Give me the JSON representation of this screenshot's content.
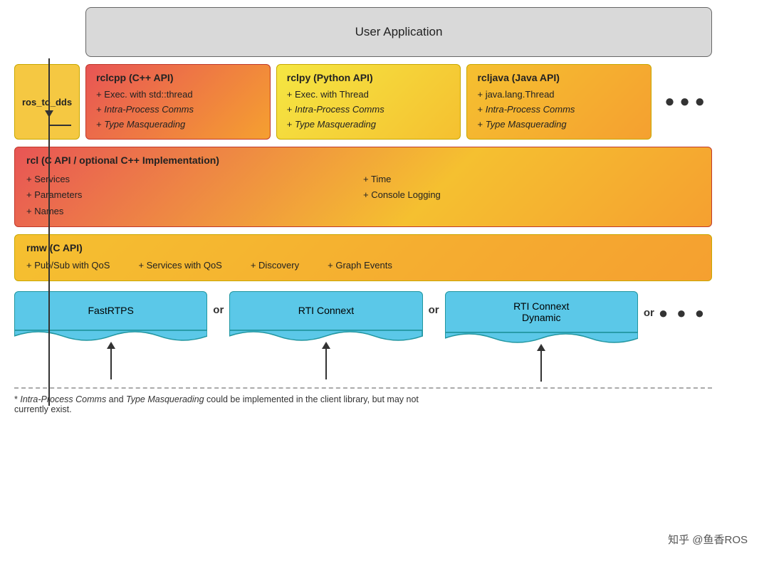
{
  "diagram": {
    "user_app": {
      "label": "User Application"
    },
    "ros_to_dds": {
      "label": "ros_to_dds"
    },
    "rclcpp": {
      "title": "rclcpp (C++ API)",
      "items": [
        "+ Exec. with std::thread",
        "+ Intra-Process Comms",
        "+ Type Masquerading"
      ]
    },
    "rclpy": {
      "title": "rclpy (Python API)",
      "items": [
        "+ Exec. with Thread",
        "+ Intra-Process Comms",
        "+ Type Masquerading"
      ]
    },
    "rcljava": {
      "title": "rcljava (Java API)",
      "items": [
        "+ java.lang.Thread",
        "+ Intra-Process Comms",
        "+ Type Masquerading"
      ]
    },
    "dots": "● ● ●",
    "rcl": {
      "title": "rcl (C API / optional C++ Implementation)",
      "col1": [
        "+ Services",
        "+ Parameters",
        "+ Names"
      ],
      "col2": [
        "+ Time",
        "+ Console Logging"
      ]
    },
    "rmw": {
      "title": "rmw (C API)",
      "items": [
        "+ Pub/Sub with QoS",
        "+ Services with QoS",
        "+ Discovery",
        "+ Graph Events"
      ]
    },
    "dds": [
      {
        "label": "FastRTPS"
      },
      {
        "label": "RTI Connext"
      },
      {
        "label": "RTI Connext\nDynamic"
      }
    ],
    "or_label": "or",
    "footer": {
      "line1": "* Intra-Process Comms and Type Masquerading could be",
      "line2": "implemented in the client library, but may not currently exist."
    },
    "watermark": "知乎 @鱼香ROS"
  }
}
